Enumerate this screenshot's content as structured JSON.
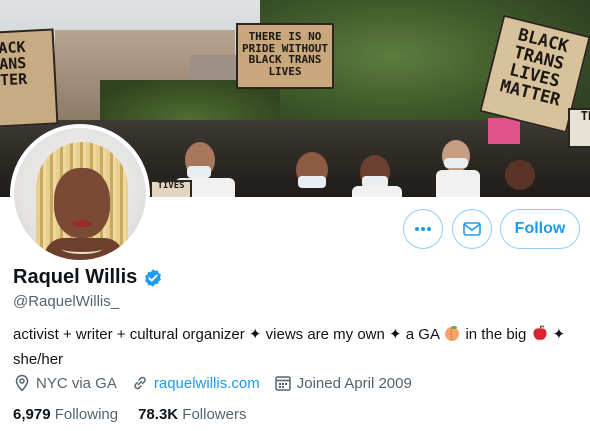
{
  "banner": {
    "sign_left": "ACK\nANS\nTER",
    "sign_center": "THERE IS NO\nPRIDE WITHOUT\nBLACK TRANS LIVES",
    "sign_right": "BLACK TRANS\nLIVES\nMATTER",
    "sign_far_right": "TR",
    "sign_small": "TIVES"
  },
  "actions": {
    "more_icon": "more-icon",
    "message_icon": "envelope-icon",
    "follow_label": "Follow"
  },
  "profile": {
    "name": "Raquel Willis",
    "verified_icon": "verified-badge-icon",
    "handle": "@RaquelWillis_",
    "bio_part1": "activist + writer + cultural organizer  ✦ views are my own ✦ a GA ",
    "bio_emoji_peach": "🍑",
    "bio_part2": " in the big ",
    "bio_emoji_apple": "🍎",
    "bio_part3": " ✦ she/her",
    "location": "NYC via GA",
    "website": "raquelwillis.com",
    "joined": "Joined April 2009"
  },
  "stats": {
    "following_count": "6,979",
    "following_label": "Following",
    "followers_count": "78.3K",
    "followers_label": "Followers"
  },
  "colors": {
    "accent": "#1d9bf0",
    "secondary_text": "#536471",
    "primary_text": "#0f1419"
  }
}
